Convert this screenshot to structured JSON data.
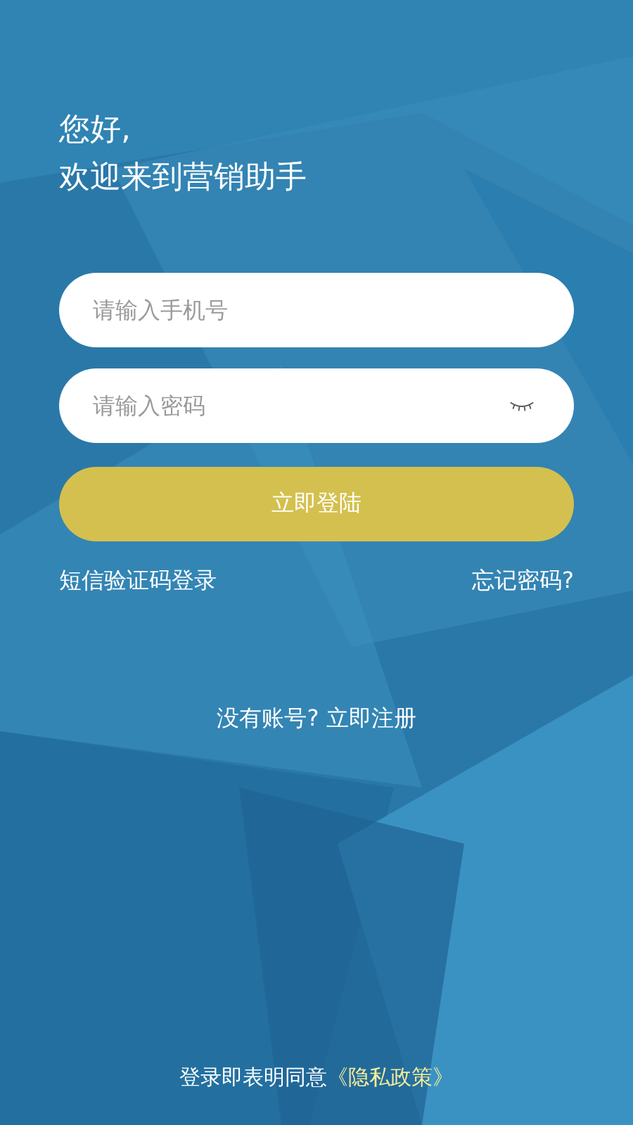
{
  "greeting": [
    "您好,",
    "欢迎来到营销助手"
  ],
  "phone_field": {
    "placeholder": "请输入手机号"
  },
  "password_field": {
    "placeholder": "请输入密码",
    "password_visible": false
  },
  "login_button": {
    "label": "立即登陆",
    "disabled": true
  },
  "sms_login_link": "短信验证码登录",
  "forgot_password_link": "忘记密码?",
  "register_prompt": "没有账号? 立即注册",
  "agreement": {
    "text": "登录即表明同意",
    "link": "《隐私政策》"
  }
}
